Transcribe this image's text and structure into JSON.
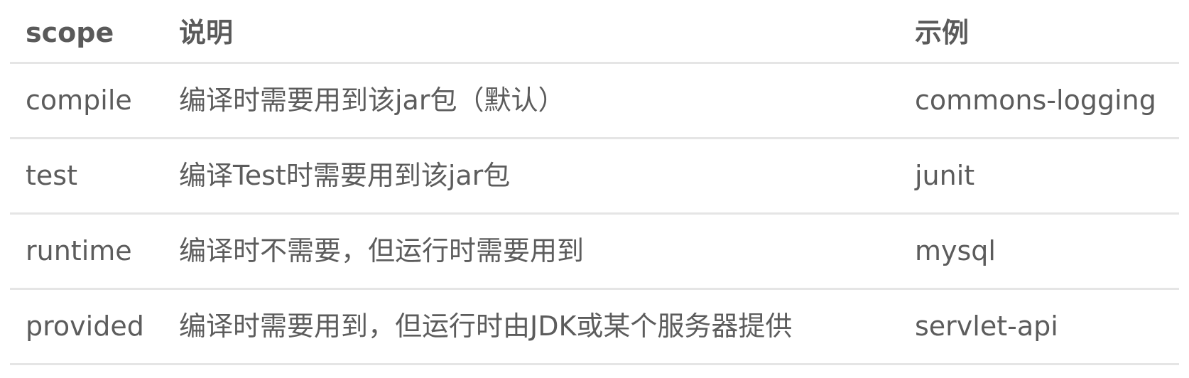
{
  "table": {
    "headers": [
      "scope",
      "说明",
      "示例"
    ],
    "rows": [
      [
        "compile",
        "编译时需要用到该jar包（默认）",
        "commons-logging"
      ],
      [
        "test",
        "编译Test时需要用到该jar包",
        "junit"
      ],
      [
        "runtime",
        "编译时不需要，但运行时需要用到",
        "mysql"
      ],
      [
        "provided",
        "编译时需要用到，但运行时由JDK或某个服务器提供",
        "servlet-api"
      ]
    ]
  }
}
